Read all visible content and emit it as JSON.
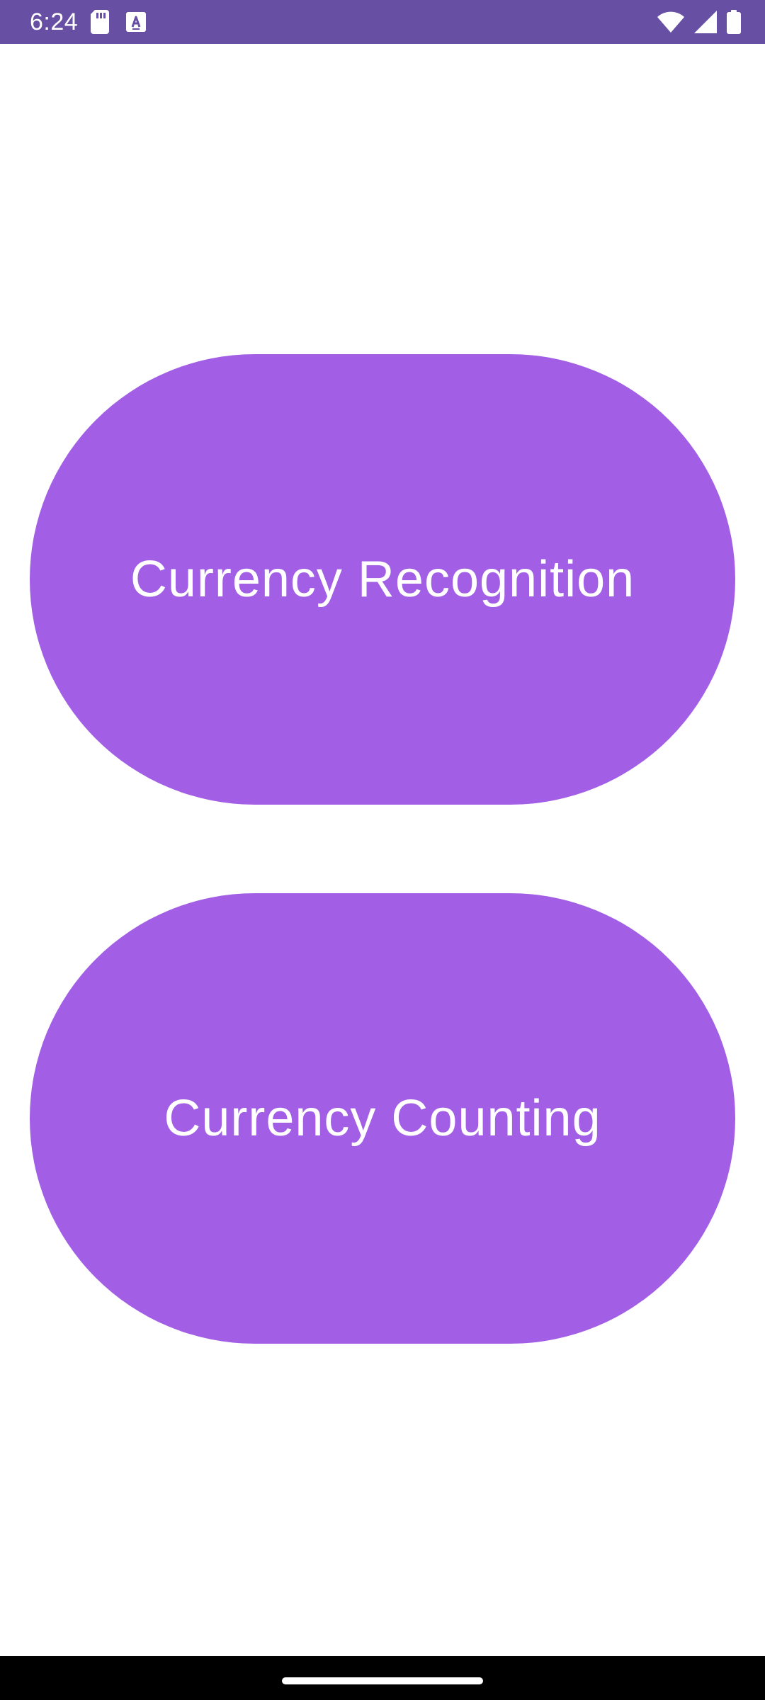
{
  "status_bar": {
    "time": "6:24",
    "background_color": "#6750a4",
    "left_icons": [
      "sd-card-icon",
      "text-a-icon"
    ],
    "right_icons": [
      "wifi-icon",
      "cellular-signal-icon",
      "battery-icon"
    ]
  },
  "main": {
    "buttons": [
      {
        "label": "Currency Recognition",
        "color": "#a25fe5"
      },
      {
        "label": "Currency Counting",
        "color": "#a25fe5"
      }
    ]
  },
  "navigation_bar": {
    "background_color": "#000000",
    "handle": "home-gesture-handle"
  }
}
